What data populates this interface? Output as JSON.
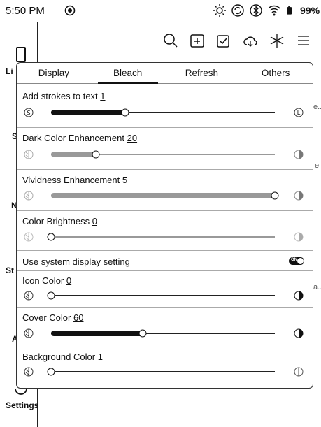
{
  "status_bar": {
    "time": "5:50 PM",
    "battery_percent": "99%",
    "icons": [
      "do-not-disturb-icon",
      "brightness-icon",
      "sync-icon",
      "bluetooth-icon",
      "wifi-icon",
      "battery-icon"
    ]
  },
  "background": {
    "sidebar_fragments": [
      "Li",
      "S",
      "N",
      "St",
      "A"
    ],
    "settings_label": "Settings",
    "toolbar_icons": [
      "search-icon",
      "add-folder-icon",
      "checklist-icon",
      "cloud-icon",
      "snowflake-icon",
      "list-icon"
    ],
    "right_fragments": [
      "e...",
      "e",
      "a..."
    ]
  },
  "panel": {
    "tabs": [
      {
        "label": "Display",
        "active": false
      },
      {
        "label": "Bleach",
        "active": true
      },
      {
        "label": "Refresh",
        "active": false
      },
      {
        "label": "Others",
        "active": false
      }
    ],
    "rows": [
      {
        "label": "Add strokes to text",
        "value": "1",
        "fraction": 0.33,
        "style": "dark",
        "icon_left": "S",
        "icon_right": "L"
      },
      {
        "label": "Dark Color Enhancement",
        "value": "20",
        "fraction": 0.2,
        "style": "grey"
      },
      {
        "label": "Vividness Enhancement",
        "value": "5",
        "fraction": 1.0,
        "style": "grey"
      },
      {
        "label": "Color Brightness",
        "value": "0",
        "fraction": 0.0,
        "style": "grey"
      },
      {
        "label": "Icon Color",
        "value": "0",
        "fraction": 0.0,
        "style": "dark"
      },
      {
        "label": "Cover Color",
        "value": "60",
        "fraction": 0.41,
        "style": "dark"
      },
      {
        "label": "Background Color",
        "value": "1",
        "fraction": 0.0,
        "style": "dark"
      }
    ],
    "toggle": {
      "label": "Use system display setting",
      "state": "ON",
      "on": true
    }
  }
}
